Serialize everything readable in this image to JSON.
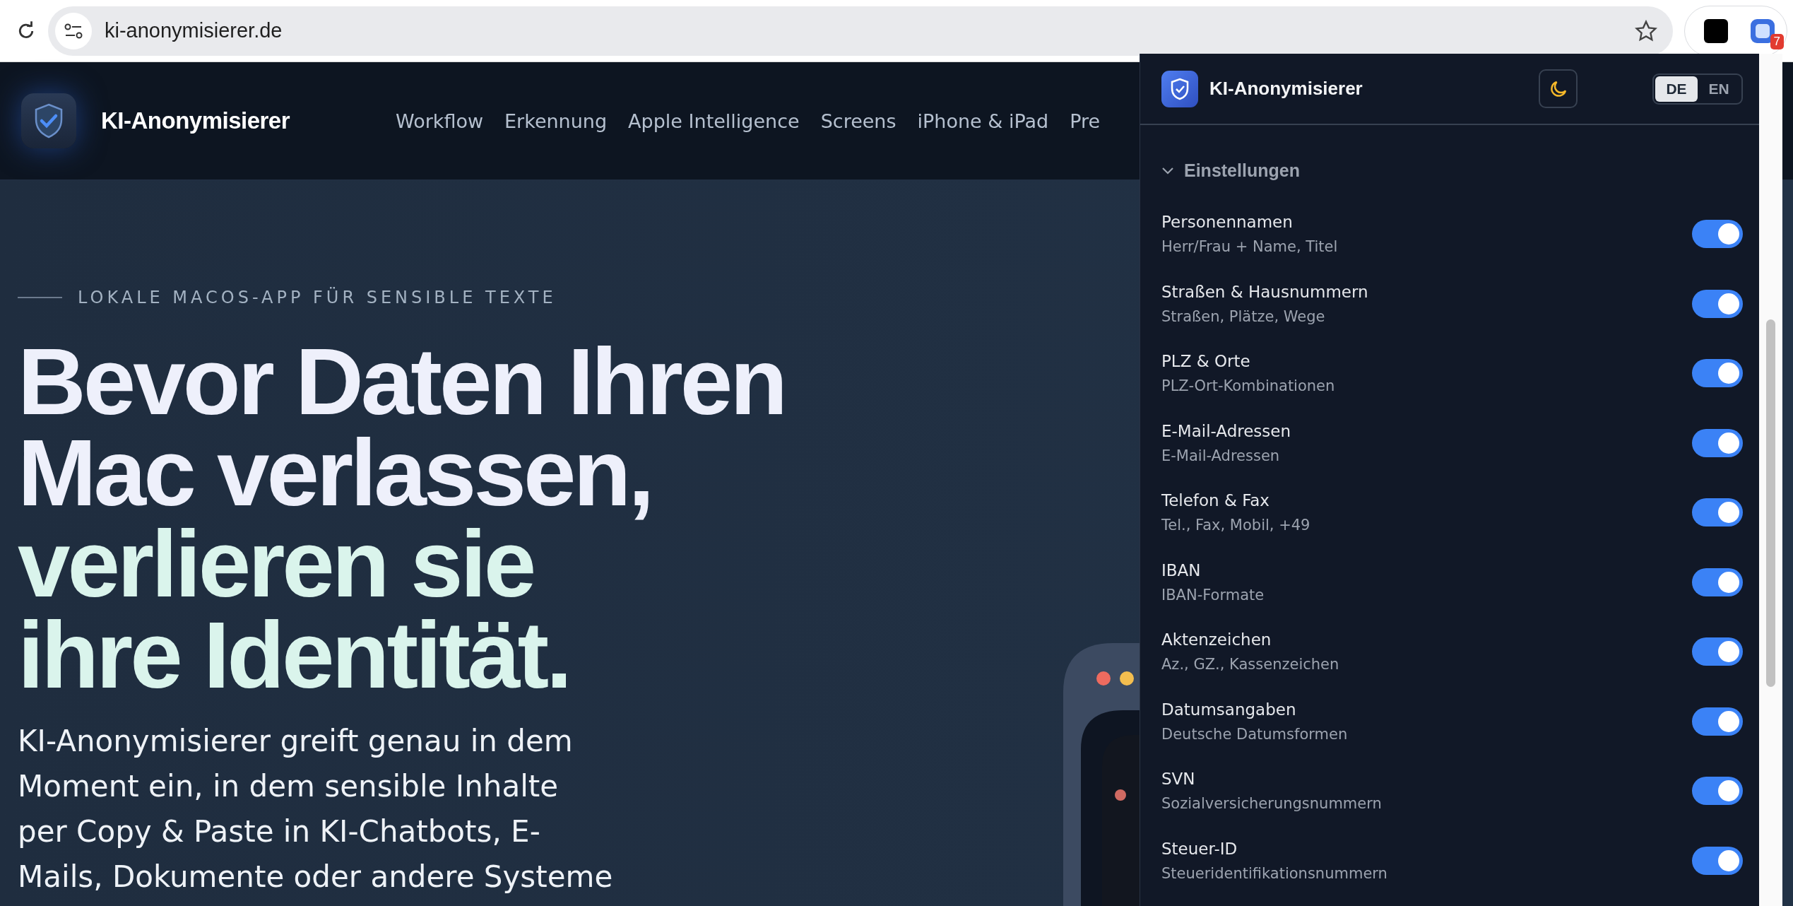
{
  "browser": {
    "url": "ki-anonymisierer.de",
    "extension_badge": "7"
  },
  "site": {
    "brand": "KI-Anonymisierer",
    "nav": [
      {
        "label": "Workflow"
      },
      {
        "label": "Erkennung"
      },
      {
        "label": "Apple Intelligence"
      },
      {
        "label": "Screens"
      },
      {
        "label": "iPhone & iPad"
      },
      {
        "label": "Pre"
      }
    ],
    "eyebrow": "LOKALE MACOS-APP FÜR SENSIBLE TEXTE",
    "headline": [
      {
        "text": "Bevor Daten Ihren",
        "kind": "light"
      },
      {
        "text": "Mac verlassen,",
        "kind": "light"
      },
      {
        "text": "verlieren sie",
        "kind": "mint"
      },
      {
        "text": "ihre Identität.",
        "kind": "mint"
      }
    ],
    "intro": [
      "KI-Anonymisierer greift genau in dem",
      "Moment ein, in dem sensible Inhalte",
      "per Copy & Paste in KI-Chatbots, E-",
      "Mails, Dokumente oder andere Systeme"
    ]
  },
  "popup": {
    "title": "KI-Anonymisierer",
    "dark_mode": true,
    "languages": [
      {
        "label": "DE",
        "selected": true
      },
      {
        "label": "EN",
        "selected": false
      }
    ],
    "section": {
      "title": "Einstellungen",
      "expanded": true
    },
    "settings": [
      {
        "name": "Personennamen",
        "hint": "Herr/Frau + Name, Titel",
        "on": true
      },
      {
        "name": "Straßen & Hausnummern",
        "hint": "Straßen, Plätze, Wege",
        "on": true
      },
      {
        "name": "PLZ & Orte",
        "hint": "PLZ-Ort-Kombinationen",
        "on": true
      },
      {
        "name": "E-Mail-Adressen",
        "hint": "E-Mail-Adressen",
        "on": true
      },
      {
        "name": "Telefon & Fax",
        "hint": "Tel., Fax, Mobil, +49",
        "on": true
      },
      {
        "name": "IBAN",
        "hint": "IBAN-Formate",
        "on": true
      },
      {
        "name": "Aktenzeichen",
        "hint": "Az., GZ., Kassenzeichen",
        "on": true
      },
      {
        "name": "Datumsangaben",
        "hint": "Deutsche Datumsformen",
        "on": true
      },
      {
        "name": "SVN",
        "hint": "Sozialversicherungsnummern",
        "on": true
      },
      {
        "name": "Steuer-ID",
        "hint": "Steueridentifikationsnummern",
        "on": true
      }
    ]
  }
}
